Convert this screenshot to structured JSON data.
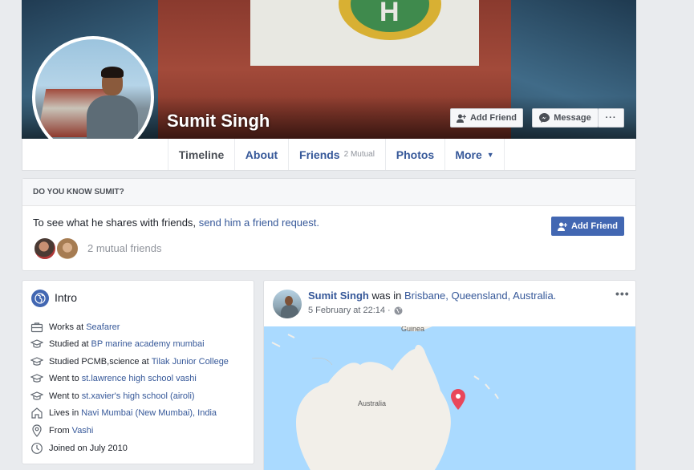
{
  "profile": {
    "name": "Sumit Singh"
  },
  "cover_actions": {
    "add_friend": "Add Friend",
    "message": "Message",
    "more": "···"
  },
  "nav": {
    "timeline": "Timeline",
    "about": "About",
    "friends": "Friends",
    "friends_sub": "2 Mutual",
    "photos": "Photos",
    "more": "More"
  },
  "know": {
    "heading": "DO YOU KNOW SUMIT?",
    "text": "To see what he shares with friends,",
    "link": "send him a friend request.",
    "button": "Add Friend",
    "mutual": "2 mutual friends"
  },
  "intro": {
    "title": "Intro",
    "rows": [
      {
        "icon": "briefcase-icon",
        "prefix": "Works at",
        "link": "Seafarer"
      },
      {
        "icon": "graduation-cap-icon",
        "prefix": "Studied at",
        "link": "BP marine academy mumbai"
      },
      {
        "icon": "graduation-cap-icon",
        "prefix": "Studied PCMB,science at",
        "link": "Tilak Junior College"
      },
      {
        "icon": "graduation-cap-icon",
        "prefix": "Went to",
        "link": "st.lawrence high school vashi"
      },
      {
        "icon": "graduation-cap-icon",
        "prefix": "Went to",
        "link": "st.xavier's high school (airoli)"
      },
      {
        "icon": "home-icon",
        "prefix": "Lives in",
        "link": "Navi Mumbai (New Mumbai), India"
      },
      {
        "icon": "location-pin-icon",
        "prefix": "From",
        "link": "Vashi"
      },
      {
        "icon": "clock-icon",
        "prefix": "Joined on July 2010",
        "link": ""
      }
    ]
  },
  "post": {
    "author": "Sumit Singh",
    "was_in": "was in",
    "place": "Brisbane, Queensland, Australia.",
    "date": "5 February at 22:14 ·",
    "menu": "•••",
    "map": {
      "label_guinea": "Guinea",
      "label_australia": "Australia"
    }
  },
  "colors": {
    "brand_blue": "#4267b2",
    "link_blue": "#365899",
    "page_bg": "#e9ebee",
    "map_pin": "#e9475b"
  }
}
